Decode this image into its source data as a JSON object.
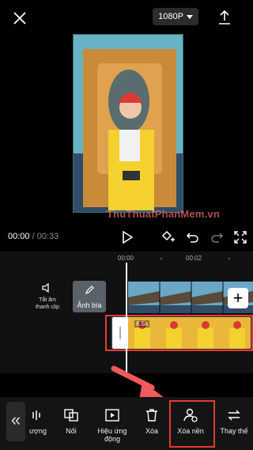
{
  "header": {
    "resolution": "1080P"
  },
  "preview": {
    "watermark": "ThuThuatPhanMem.vn"
  },
  "playback": {
    "current": "00:00",
    "separator": " / ",
    "total": "00:33"
  },
  "timeline": {
    "ruler": [
      "00:00",
      "00:02"
    ],
    "mute_label_line1": "Tắt âm",
    "mute_label_line2": "thanh clip",
    "cover_label": "Ảnh bìa",
    "clip_duration": "6.5s"
  },
  "toolbar": {
    "items": [
      {
        "label": "ượng"
      },
      {
        "label": "Nối"
      },
      {
        "label_line1": "Hiệu ứng",
        "label_line2": "động"
      },
      {
        "label": "Xóa"
      },
      {
        "label": "Xóa nền"
      },
      {
        "label": "Thay thế"
      }
    ]
  },
  "colors": {
    "highlight": "#e53935",
    "arrow": "#f05a5a",
    "background": "#000000"
  }
}
